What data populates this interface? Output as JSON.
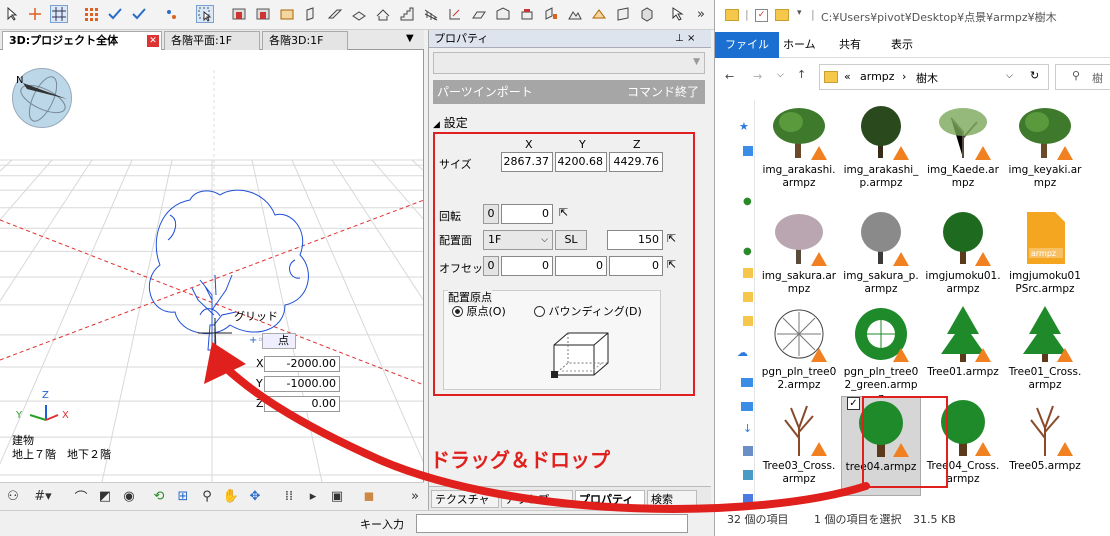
{
  "viewport": {
    "tabs": [
      "3D:プロジェクト全体",
      "各階平面:1F",
      "各階3D:1F"
    ],
    "compass_label": "N",
    "grid_label": "グリッド",
    "point_label": "点",
    "coords": {
      "x_label": "X",
      "y_label": "Y",
      "z_label": "Z",
      "x": "-2000.00",
      "y": "-1000.00",
      "z": "0.00"
    },
    "building_label": "建物",
    "floors_label": "地上７階　地下２階",
    "axis": {
      "x": "X",
      "y": "Y",
      "z": "Z"
    }
  },
  "properties": {
    "title": "プロパティ",
    "parts_import": "パーツインポート",
    "command_end": "コマンド終了",
    "settings": "設定",
    "col_x": "X",
    "col_y": "Y",
    "col_z": "Z",
    "size_label": "サイズ",
    "size_x": "2867.37",
    "size_y": "4200.68",
    "size_z": "4429.76",
    "rotation_label": "回転",
    "rotation_btn": "0",
    "rotation_value": "0",
    "placement_label": "配置面",
    "placement_floor": "1F",
    "placement_sl": "SL",
    "placement_value": "150",
    "offset_label": "オフセット",
    "offset_btn": "0",
    "offset_x": "0",
    "offset_y": "0",
    "offset_z": "0",
    "origin_group": "配置原点",
    "origin_point": "原点(O)",
    "origin_bounding": "バウンディング(D)",
    "bottom_tabs": [
      "テクスチャ",
      "アウトプ...",
      "プロパティ",
      "検索"
    ]
  },
  "drag_drop_label": "ドラッグ＆ドロップ",
  "status": {
    "key_input": "キー入力"
  },
  "explorer": {
    "title_path": "C:¥Users¥pivot¥Desktop¥点景¥armpz¥樹木",
    "ribbon": [
      "ファイル",
      "ホーム",
      "共有",
      "表示"
    ],
    "breadcrumb": [
      "«",
      "armpz",
      "›",
      "樹木"
    ],
    "search_placeholder": "樹",
    "files": [
      {
        "name": "img_arakashi.armpz",
        "type": "tree-img"
      },
      {
        "name": "img_arakashi_p.armpz",
        "type": "tree-img-dark"
      },
      {
        "name": "img_Kaede.armpz",
        "type": "tree-img-thin"
      },
      {
        "name": "img_keyaki.armpz",
        "type": "tree-img"
      },
      {
        "name": "img_sakura.armpz",
        "type": "tree-img-pink"
      },
      {
        "name": "img_sakura_p.armpz",
        "type": "tree-img-gray"
      },
      {
        "name": "imgjumoku01.armpz",
        "type": "tree-round-dark"
      },
      {
        "name": "imgjumoku01PSrc.armpz",
        "type": "armpz-file"
      },
      {
        "name": "pgn_pln_tree02.armpz",
        "type": "plan-outline"
      },
      {
        "name": "pgn_pln_tree02_green.armpz",
        "type": "plan-green"
      },
      {
        "name": "Tree01.armpz",
        "type": "conifer"
      },
      {
        "name": "Tree01_Cross.armpz",
        "type": "conifer"
      },
      {
        "name": "Tree03_Cross.armpz",
        "type": "bare-tree"
      },
      {
        "name": "tree04.armpz",
        "type": "round-tree",
        "selected": true
      },
      {
        "name": "Tree04_Cross.armpz",
        "type": "round-tree"
      },
      {
        "name": "Tree05.armpz",
        "type": "bare-tree"
      }
    ],
    "status_count": "32 個の項目",
    "status_selected": "1 個の項目を選択",
    "status_size": "31.5 KB"
  },
  "colors": {
    "highlight_red": "#e0201c",
    "tree_green": "#1e8a2a",
    "tree_outline": "#1f4fd6"
  }
}
